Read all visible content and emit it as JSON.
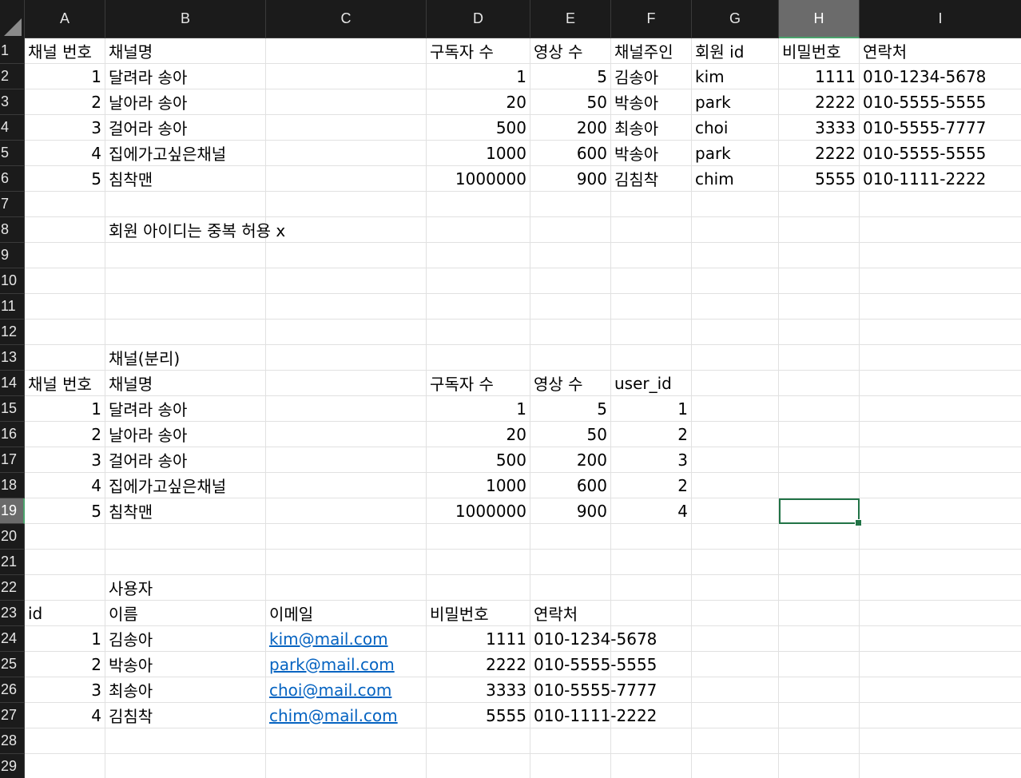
{
  "columns": [
    "A",
    "B",
    "C",
    "D",
    "E",
    "F",
    "G",
    "H",
    "I"
  ],
  "selected_column": "H",
  "rows": [
    {
      "n": "1",
      "cells": [
        {
          "c": "A",
          "v": "채널 번호",
          "t": "txt"
        },
        {
          "c": "B",
          "v": "채널명",
          "t": "txt"
        },
        {
          "c": "D",
          "v": "구독자 수",
          "t": "txt"
        },
        {
          "c": "E",
          "v": "영상 수",
          "t": "txt"
        },
        {
          "c": "F",
          "v": "채널주인",
          "t": "txt"
        },
        {
          "c": "G",
          "v": "회원 id",
          "t": "txt"
        },
        {
          "c": "H",
          "v": "비밀번호",
          "t": "txt"
        },
        {
          "c": "I",
          "v": "연락처",
          "t": "txt"
        }
      ]
    },
    {
      "n": "2",
      "cells": [
        {
          "c": "A",
          "v": "1",
          "t": "num"
        },
        {
          "c": "B",
          "v": "달려라 송아",
          "t": "txt"
        },
        {
          "c": "D",
          "v": "1",
          "t": "num"
        },
        {
          "c": "E",
          "v": "5",
          "t": "num"
        },
        {
          "c": "F",
          "v": "김송아",
          "t": "txt"
        },
        {
          "c": "G",
          "v": "kim",
          "t": "txt"
        },
        {
          "c": "H",
          "v": "1111",
          "t": "num"
        },
        {
          "c": "I",
          "v": "010-1234-5678",
          "t": "txt"
        }
      ]
    },
    {
      "n": "3",
      "cells": [
        {
          "c": "A",
          "v": "2",
          "t": "num"
        },
        {
          "c": "B",
          "v": "날아라 송아",
          "t": "txt"
        },
        {
          "c": "D",
          "v": "20",
          "t": "num"
        },
        {
          "c": "E",
          "v": "50",
          "t": "num"
        },
        {
          "c": "F",
          "v": "박송아",
          "t": "txt"
        },
        {
          "c": "G",
          "v": "park",
          "t": "txt"
        },
        {
          "c": "H",
          "v": "2222",
          "t": "num"
        },
        {
          "c": "I",
          "v": "010-5555-5555",
          "t": "txt"
        }
      ]
    },
    {
      "n": "4",
      "cells": [
        {
          "c": "A",
          "v": "3",
          "t": "num"
        },
        {
          "c": "B",
          "v": "걸어라 송아",
          "t": "txt"
        },
        {
          "c": "D",
          "v": "500",
          "t": "num"
        },
        {
          "c": "E",
          "v": "200",
          "t": "num"
        },
        {
          "c": "F",
          "v": "최송아",
          "t": "txt"
        },
        {
          "c": "G",
          "v": "choi",
          "t": "txt"
        },
        {
          "c": "H",
          "v": "3333",
          "t": "num"
        },
        {
          "c": "I",
          "v": "010-5555-7777",
          "t": "txt"
        }
      ]
    },
    {
      "n": "5",
      "cells": [
        {
          "c": "A",
          "v": "4",
          "t": "num"
        },
        {
          "c": "B",
          "v": "집에가고싶은채널",
          "t": "txt"
        },
        {
          "c": "D",
          "v": "1000",
          "t": "num"
        },
        {
          "c": "E",
          "v": "600",
          "t": "num"
        },
        {
          "c": "F",
          "v": "박송아",
          "t": "txt"
        },
        {
          "c": "G",
          "v": "park",
          "t": "txt"
        },
        {
          "c": "H",
          "v": "2222",
          "t": "num"
        },
        {
          "c": "I",
          "v": "010-5555-5555",
          "t": "txt"
        }
      ]
    },
    {
      "n": "6",
      "cells": [
        {
          "c": "A",
          "v": "5",
          "t": "num"
        },
        {
          "c": "B",
          "v": "침착맨",
          "t": "txt"
        },
        {
          "c": "D",
          "v": "1000000",
          "t": "num"
        },
        {
          "c": "E",
          "v": "900",
          "t": "num"
        },
        {
          "c": "F",
          "v": "김침착",
          "t": "txt"
        },
        {
          "c": "G",
          "v": "chim",
          "t": "txt"
        },
        {
          "c": "H",
          "v": "5555",
          "t": "num"
        },
        {
          "c": "I",
          "v": "010-1111-2222",
          "t": "txt"
        }
      ]
    },
    {
      "n": "7",
      "cells": []
    },
    {
      "n": "8",
      "cells": [
        {
          "c": "B",
          "v": "회원 아이디는 중복 허용 x",
          "t": "txt"
        }
      ]
    },
    {
      "n": "9",
      "cells": []
    },
    {
      "n": "10",
      "cells": []
    },
    {
      "n": "11",
      "cells": []
    },
    {
      "n": "12",
      "cells": []
    },
    {
      "n": "13",
      "cells": [
        {
          "c": "B",
          "v": "채널(분리)",
          "t": "txt"
        }
      ]
    },
    {
      "n": "14",
      "cells": [
        {
          "c": "A",
          "v": "채널 번호",
          "t": "txt"
        },
        {
          "c": "B",
          "v": "채널명",
          "t": "txt"
        },
        {
          "c": "D",
          "v": "구독자 수",
          "t": "txt"
        },
        {
          "c": "E",
          "v": "영상 수",
          "t": "txt"
        },
        {
          "c": "F",
          "v": "user_id",
          "t": "txt"
        }
      ]
    },
    {
      "n": "15",
      "cells": [
        {
          "c": "A",
          "v": "1",
          "t": "num"
        },
        {
          "c": "B",
          "v": "달려라 송아",
          "t": "txt"
        },
        {
          "c": "D",
          "v": "1",
          "t": "num"
        },
        {
          "c": "E",
          "v": "5",
          "t": "num"
        },
        {
          "c": "F",
          "v": "1",
          "t": "num"
        }
      ]
    },
    {
      "n": "16",
      "cells": [
        {
          "c": "A",
          "v": "2",
          "t": "num"
        },
        {
          "c": "B",
          "v": "날아라 송아",
          "t": "txt"
        },
        {
          "c": "D",
          "v": "20",
          "t": "num"
        },
        {
          "c": "E",
          "v": "50",
          "t": "num"
        },
        {
          "c": "F",
          "v": "2",
          "t": "num"
        }
      ]
    },
    {
      "n": "17",
      "cells": [
        {
          "c": "A",
          "v": "3",
          "t": "num"
        },
        {
          "c": "B",
          "v": "걸어라 송아",
          "t": "txt"
        },
        {
          "c": "D",
          "v": "500",
          "t": "num"
        },
        {
          "c": "E",
          "v": "200",
          "t": "num"
        },
        {
          "c": "F",
          "v": "3",
          "t": "num"
        }
      ]
    },
    {
      "n": "18",
      "cells": [
        {
          "c": "A",
          "v": "4",
          "t": "num"
        },
        {
          "c": "B",
          "v": "집에가고싶은채널",
          "t": "txt"
        },
        {
          "c": "D",
          "v": "1000",
          "t": "num"
        },
        {
          "c": "E",
          "v": "600",
          "t": "num"
        },
        {
          "c": "F",
          "v": "2",
          "t": "num"
        }
      ]
    },
    {
      "n": "19",
      "cells": [
        {
          "c": "A",
          "v": "5",
          "t": "num"
        },
        {
          "c": "B",
          "v": "침착맨",
          "t": "txt"
        },
        {
          "c": "D",
          "v": "1000000",
          "t": "num"
        },
        {
          "c": "E",
          "v": "900",
          "t": "num"
        },
        {
          "c": "F",
          "v": "4",
          "t": "num"
        }
      ]
    },
    {
      "n": "20",
      "cells": []
    },
    {
      "n": "21",
      "cells": []
    },
    {
      "n": "22",
      "cells": [
        {
          "c": "B",
          "v": "사용자",
          "t": "txt"
        }
      ]
    },
    {
      "n": "23",
      "cells": [
        {
          "c": "A",
          "v": "id",
          "t": "txt"
        },
        {
          "c": "B",
          "v": "이름",
          "t": "txt"
        },
        {
          "c": "C",
          "v": "이메일",
          "t": "txt"
        },
        {
          "c": "D",
          "v": "비밀번호",
          "t": "txt"
        },
        {
          "c": "E",
          "v": "연락처",
          "t": "txt"
        }
      ]
    },
    {
      "n": "24",
      "cells": [
        {
          "c": "A",
          "v": "1",
          "t": "num"
        },
        {
          "c": "B",
          "v": "김송아",
          "t": "txt"
        },
        {
          "c": "C",
          "v": "kim@mail.com",
          "t": "link"
        },
        {
          "c": "D",
          "v": "1111",
          "t": "num"
        },
        {
          "c": "E",
          "v": "010-1234-5678",
          "t": "txt"
        }
      ]
    },
    {
      "n": "25",
      "cells": [
        {
          "c": "A",
          "v": "2",
          "t": "num"
        },
        {
          "c": "B",
          "v": "박송아",
          "t": "txt"
        },
        {
          "c": "C",
          "v": "park@mail.com",
          "t": "link"
        },
        {
          "c": "D",
          "v": "2222",
          "t": "num"
        },
        {
          "c": "E",
          "v": "010-5555-5555",
          "t": "txt"
        }
      ]
    },
    {
      "n": "26",
      "cells": [
        {
          "c": "A",
          "v": "3",
          "t": "num"
        },
        {
          "c": "B",
          "v": "최송아",
          "t": "txt"
        },
        {
          "c": "C",
          "v": "choi@mail.com",
          "t": "link"
        },
        {
          "c": "D",
          "v": "3333",
          "t": "num"
        },
        {
          "c": "E",
          "v": "010-5555-7777",
          "t": "txt"
        }
      ]
    },
    {
      "n": "27",
      "cells": [
        {
          "c": "A",
          "v": "4",
          "t": "num"
        },
        {
          "c": "B",
          "v": "김침착",
          "t": "txt"
        },
        {
          "c": "C",
          "v": "chim@mail.com",
          "t": "link"
        },
        {
          "c": "D",
          "v": "5555",
          "t": "num"
        },
        {
          "c": "E",
          "v": "010-1111-2222",
          "t": "txt"
        }
      ]
    },
    {
      "n": "28",
      "cells": []
    },
    {
      "n": "29",
      "cells": []
    }
  ],
  "active_cell": {
    "col": "H",
    "row": "19"
  },
  "colors": {
    "header_bg": "#1b1b1b",
    "selected_header": "#6b6b6b",
    "selection": "#217346",
    "link": "#0563c1",
    "grid": "#e1e1e1"
  }
}
